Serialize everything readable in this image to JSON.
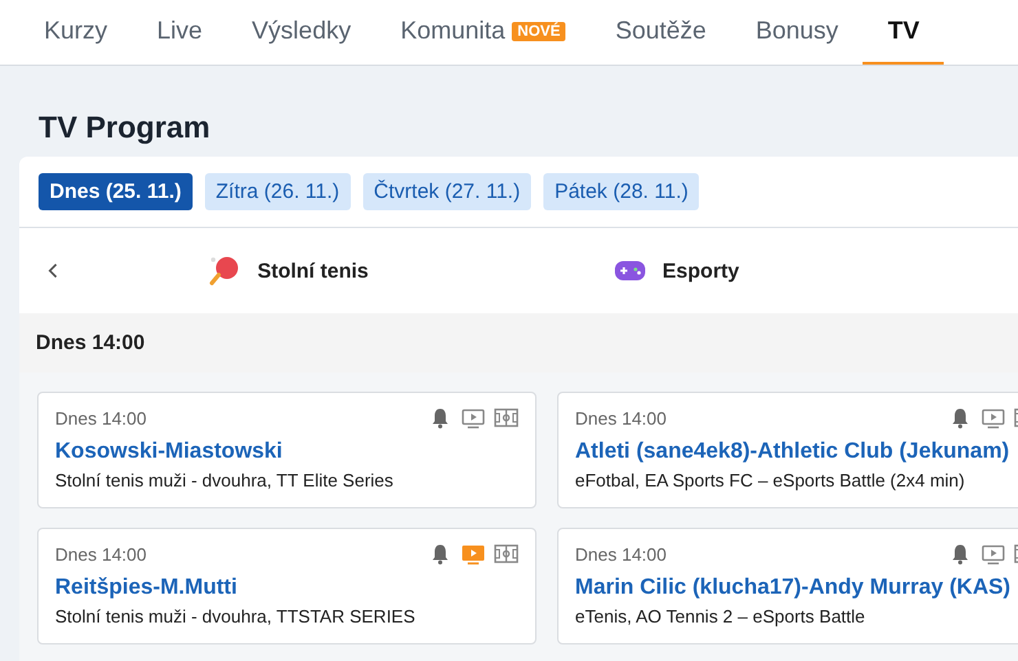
{
  "nav": {
    "tabs": [
      {
        "label": "Kurzy",
        "selected": false
      },
      {
        "label": "Live",
        "selected": false
      },
      {
        "label": "Výsledky",
        "selected": false
      },
      {
        "label": "Komunita",
        "badge": "NOVÉ",
        "selected": false
      },
      {
        "label": "Soutěže",
        "selected": false
      },
      {
        "label": "Bonusy",
        "selected": false
      },
      {
        "label": "TV",
        "selected": true
      }
    ]
  },
  "page_title": "TV Program",
  "days": [
    {
      "label": "Dnes (25. 11.)",
      "selected": true
    },
    {
      "label": "Zítra (26. 11.)",
      "selected": false
    },
    {
      "label": "Čtvrtek (27. 11.)",
      "selected": false
    },
    {
      "label": "Pátek (28. 11.)",
      "selected": false
    }
  ],
  "sports": [
    {
      "kind": "table-tennis",
      "label": "Stolní tenis"
    },
    {
      "kind": "esports",
      "label": "Esporty"
    }
  ],
  "section_header": "Dnes 14:00",
  "events": [
    {
      "time": "Dnes 14:00",
      "title": "Kosowski-Miastowski",
      "subtitle": "Stolní tenis muži - dvouhra, TT Elite Series",
      "stream_live": false
    },
    {
      "time": "Dnes 14:00",
      "title": "Atleti (sane4ek8)-Athletic Club (Jekunam)",
      "subtitle": "eFotbal, EA Sports FC – eSports Battle (2x4 min)",
      "stream_live": false
    },
    {
      "time": "Dnes 14:00",
      "title": "Reitšpies-M.Mutti",
      "subtitle": "Stolní tenis muži - dvouhra, TTSTAR SERIES",
      "stream_live": true
    },
    {
      "time": "Dnes 14:00",
      "title": "Marin Cilic (klucha17)-Andy Murray (KAS)",
      "subtitle": "eTenis, AO Tennis 2 – eSports Battle",
      "stream_live": false
    }
  ]
}
